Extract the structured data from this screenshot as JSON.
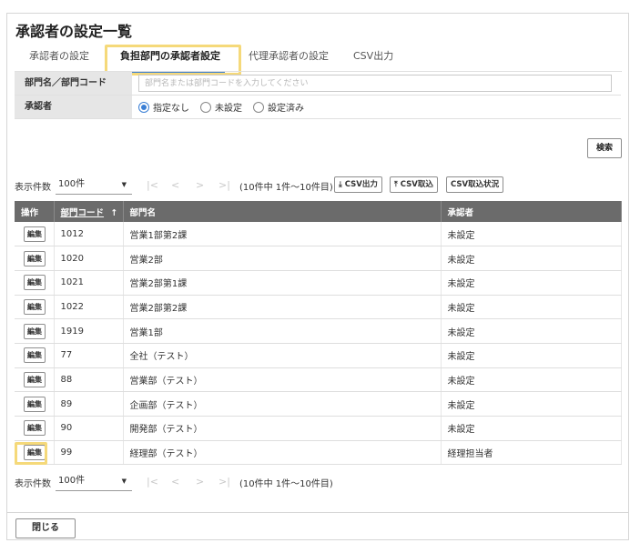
{
  "page": {
    "title": "承認者の設定一覧"
  },
  "tabs": [
    {
      "label": "承認者の設定"
    },
    {
      "label": "負担部門の承認者設定"
    },
    {
      "label": "代理承認者の設定"
    },
    {
      "label": "CSV出力"
    }
  ],
  "filter": {
    "dept_label": "部門名／部門コード",
    "dept_placeholder": "部門名または部門コードを入力してください",
    "approver_label": "承認者",
    "radio_options": [
      "指定なし",
      "未設定",
      "設定済み"
    ],
    "radio_selected": "指定なし",
    "search_label": "検索"
  },
  "pager": {
    "label": "表示件数",
    "per_page": "100件",
    "first": "|<",
    "prev": "<",
    "next": ">",
    "last": ">|",
    "info": "(10件中 1件〜10件目)"
  },
  "toolbar": {
    "csv_export": "CSV出力",
    "csv_import": "CSV取込",
    "csv_status": "CSV取込状況"
  },
  "table": {
    "headers": {
      "op": "操作",
      "code": "部門コード",
      "name": "部門名",
      "approver": "承認者"
    },
    "sort_arrow": "↑",
    "edit_label": "編集",
    "rows": [
      {
        "code": "1012",
        "name": "営業1部第2課",
        "approver": "未設定"
      },
      {
        "code": "1020",
        "name": "営業2部",
        "approver": "未設定"
      },
      {
        "code": "1021",
        "name": "営業2部第1課",
        "approver": "未設定"
      },
      {
        "code": "1022",
        "name": "営業2部第2課",
        "approver": "未設定"
      },
      {
        "code": "1919",
        "name": "営業1部",
        "approver": "未設定"
      },
      {
        "code": "77",
        "name": "全社（テスト）",
        "approver": "未設定"
      },
      {
        "code": "88",
        "name": "営業部（テスト）",
        "approver": "未設定"
      },
      {
        "code": "89",
        "name": "企画部（テスト）",
        "approver": "未設定"
      },
      {
        "code": "90",
        "name": "開発部（テスト）",
        "approver": "未設定"
      },
      {
        "code": "99",
        "name": "経理部（テスト）",
        "approver": "経理担当者"
      }
    ]
  },
  "footer": {
    "close_label": "閉じる"
  },
  "colors": {
    "accent": "#3a7fd5",
    "highlight": "#f5d97a",
    "header_bg": "#6b6b6b",
    "unset": "#e02020"
  }
}
